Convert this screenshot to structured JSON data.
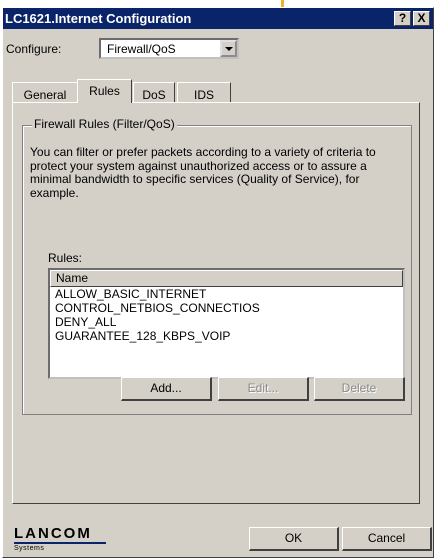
{
  "window": {
    "title": "LC1621.Internet Configuration"
  },
  "titlebar_buttons": {
    "help": "?",
    "close": "X"
  },
  "configure": {
    "label": "Configure:",
    "value": "Firewall/QoS"
  },
  "tabs": [
    {
      "label": "General"
    },
    {
      "label": "Rules"
    },
    {
      "label": "DoS"
    },
    {
      "label": "IDS"
    }
  ],
  "group": {
    "title": "Firewall Rules (Filter/QoS)",
    "description": "You can filter or prefer packets according to a variety of criteria to protect your system against unauthorized access or to assure a minimal bandwidth to specific services (Quality of Service), for example."
  },
  "rules": {
    "label": "Rules:",
    "column": "Name",
    "items": [
      "ALLOW_BASIC_INTERNET",
      "CONTROL_NETBIOS_CONNECTIOS",
      "DENY_ALL",
      "GUARANTEE_128_KBPS_VOIP"
    ]
  },
  "buttons": {
    "add": "Add...",
    "edit": "Edit...",
    "delete": "Delete",
    "ok": "OK",
    "cancel": "Cancel"
  },
  "brand": {
    "name": "LANCOM",
    "subtitle": "Systems"
  },
  "colors": {
    "titlebar": "#0a246a",
    "face": "#d4d0c8",
    "accent": "#f0b02a"
  }
}
